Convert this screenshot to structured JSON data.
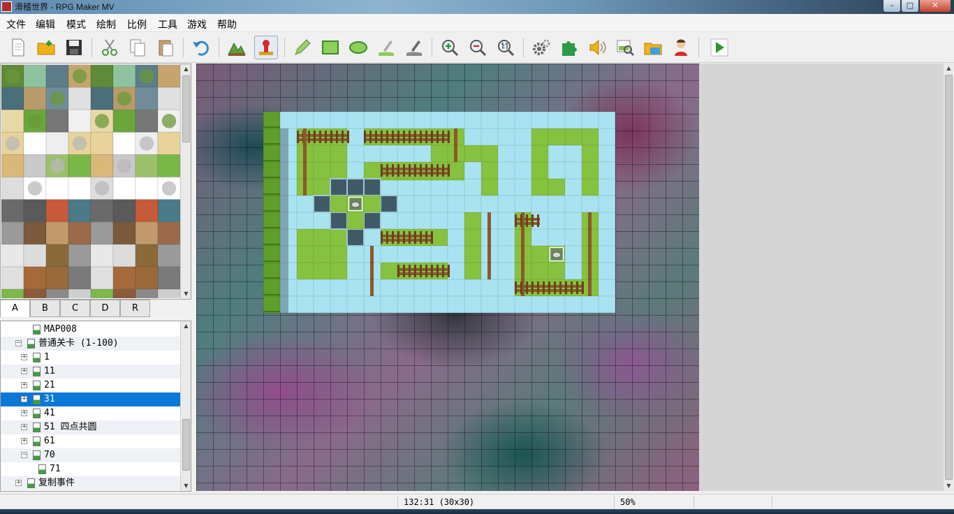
{
  "window": {
    "title": "滑稽世界 - RPG Maker MV",
    "minimize": "–",
    "maximize": "□",
    "close": "✕"
  },
  "menu": [
    "文件",
    "编辑",
    "模式",
    "绘制",
    "比例",
    "工具",
    "游戏",
    "帮助"
  ],
  "toolbar": {
    "buttons": [
      {
        "name": "new-project-icon"
      },
      {
        "name": "open-project-icon"
      },
      {
        "name": "save-project-icon"
      },
      {
        "name": "cut-icon"
      },
      {
        "name": "copy-icon"
      },
      {
        "name": "paste-icon"
      },
      {
        "name": "undo-icon"
      },
      {
        "name": "map-mode-icon"
      },
      {
        "name": "event-mode-icon",
        "active": true
      },
      {
        "name": "pencil-icon"
      },
      {
        "name": "rectangle-icon"
      },
      {
        "name": "ellipse-icon"
      },
      {
        "name": "fill-icon"
      },
      {
        "name": "shadow-pen-icon"
      },
      {
        "name": "zoom-in-icon"
      },
      {
        "name": "zoom-out-icon"
      },
      {
        "name": "zoom-actual-icon"
      },
      {
        "name": "database-icon"
      },
      {
        "name": "plugin-manager-icon"
      },
      {
        "name": "sound-test-icon"
      },
      {
        "name": "event-searcher-icon"
      },
      {
        "name": "resource-manager-icon"
      },
      {
        "name": "character-generator-icon"
      },
      {
        "name": "playtest-icon"
      }
    ]
  },
  "palette": {
    "tabs": [
      "A",
      "B",
      "C",
      "D",
      "R"
    ],
    "active_tab": "A"
  },
  "maptree": {
    "items": [
      {
        "label": "MAP008",
        "depth": 2,
        "expander": "",
        "selected": false
      },
      {
        "label": "普通关卡 (1-100)",
        "depth": 1,
        "expander": "−",
        "selected": false
      },
      {
        "label": "1",
        "depth": 2,
        "expander": "+",
        "selected": false
      },
      {
        "label": "11",
        "depth": 2,
        "expander": "+",
        "selected": false
      },
      {
        "label": "21",
        "depth": 2,
        "expander": "+",
        "selected": false
      },
      {
        "label": "31",
        "depth": 2,
        "expander": "+",
        "selected": true
      },
      {
        "label": "41",
        "depth": 2,
        "expander": "+",
        "selected": false
      },
      {
        "label": "51 四点共圆",
        "depth": 2,
        "expander": "+",
        "selected": false
      },
      {
        "label": "61",
        "depth": 2,
        "expander": "+",
        "selected": false
      },
      {
        "label": "70",
        "depth": 2,
        "expander": "−",
        "selected": false
      },
      {
        "label": "71",
        "depth": 3,
        "expander": "",
        "selected": false
      },
      {
        "label": "复制事件",
        "depth": 1,
        "expander": "+",
        "selected": false
      }
    ]
  },
  "statusbar": {
    "coords": "132:31 (30x30)",
    "zoom": "50%"
  },
  "colors": {
    "water": "#a9e3f2",
    "grass": "#86c23f",
    "hedge": "#5f9e2a",
    "fence": "#8a5a2c",
    "selection": "#0a78d7"
  }
}
